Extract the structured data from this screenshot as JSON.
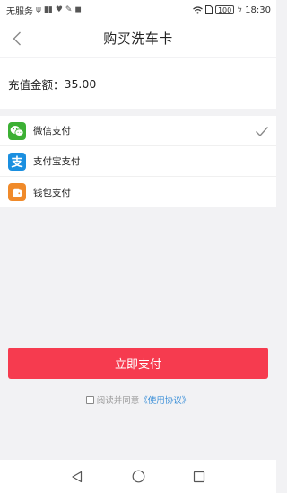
{
  "status_bar": {
    "carrier": "无服务",
    "battery": "100",
    "time": "18:30"
  },
  "header": {
    "title": "购买洗车卡",
    "back_icon": "chevron-left-icon"
  },
  "recharge": {
    "label": "充值金额：",
    "amount": "35.00"
  },
  "payment_methods": [
    {
      "label": "微信支付",
      "icon": "wechat-pay-icon",
      "color": "#3cb034",
      "selected": true
    },
    {
      "label": "支付宝支付",
      "icon": "alipay-icon",
      "color": "#1a8fe0",
      "selected": false
    },
    {
      "label": "钱包支付",
      "icon": "wallet-icon",
      "color": "#f08a2a",
      "selected": false
    }
  ],
  "pay_button": {
    "label": "立即支付",
    "color": "#f63b4f"
  },
  "agreement": {
    "text": "阅读并同意",
    "link": "《使用协议》",
    "checked": false
  },
  "nav_bar": {
    "back_icon": "triangle-back-icon",
    "home_icon": "circle-home-icon",
    "recents_icon": "square-recents-icon"
  }
}
